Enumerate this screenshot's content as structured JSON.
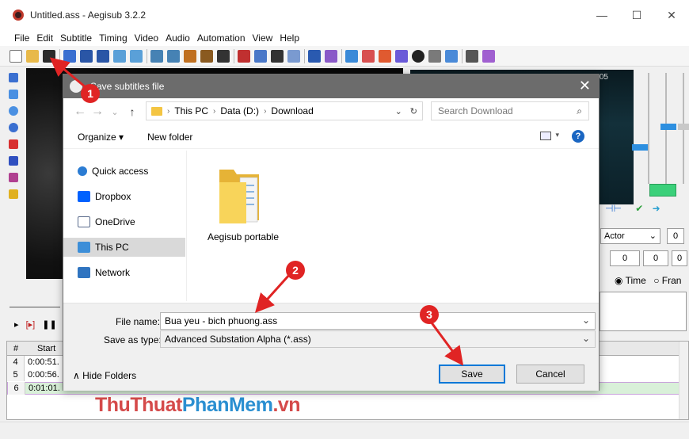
{
  "window": {
    "title": "Untitled.ass - Aegisub 3.2.2",
    "minimize": "—",
    "maximize": "☐",
    "close": "✕"
  },
  "menu": [
    "File",
    "Edit",
    "Subtitle",
    "Timing",
    "Video",
    "Audio",
    "Automation",
    "View",
    "Help"
  ],
  "right_panel": {
    "time_label": "05",
    "actor_label": "Actor",
    "actor_value": "0",
    "field_a": "0",
    "field_b": "0",
    "field_c": "0",
    "time_radio": "Time",
    "frame_radio": "Fran"
  },
  "grid": {
    "col_num": "#",
    "col_start": "Start",
    "rows": [
      {
        "num": "4",
        "start": "0:00:51."
      },
      {
        "num": "5",
        "start": "0:00:56."
      },
      {
        "num": "6",
        "start": "0:01:01."
      }
    ]
  },
  "watermark": {
    "part1": "ThuThuat",
    "part2": "PhanMem",
    "part3": ".vn"
  },
  "dialog": {
    "title": "Save subtitles file",
    "close": "✕",
    "back": "←",
    "forward": "→",
    "recent": "⌄",
    "up": "↑",
    "breadcrumbs": [
      "This PC",
      "Data (D:)",
      "Download"
    ],
    "crumb_sep": "›",
    "addr_dropdown": "⌄",
    "refresh": "↻",
    "search_placeholder": "Search Download",
    "search_icon": "⌕",
    "organize": "Organize ▾",
    "new_folder": "New folder",
    "view_dropdown": "▾",
    "help": "?",
    "nav": [
      {
        "label": "Quick access",
        "color": "#2b7cd3"
      },
      {
        "label": "Dropbox",
        "color": "#0061fe"
      },
      {
        "label": "OneDrive",
        "color": "#5a6b8c"
      },
      {
        "label": "This PC",
        "color": "#3c8ed8"
      },
      {
        "label": "Network",
        "color": "#2f74c0"
      }
    ],
    "folder_item": "Aegisub portable",
    "file_name_label": "File name:",
    "file_name_value": "Bua yeu - bich phuong.ass",
    "save_type_label": "Save as type:",
    "save_type_value": "Advanced Substation Alpha (*.ass)",
    "dropdown_glyph": "⌄",
    "hide_folders": "∧  Hide Folders",
    "save": "Save",
    "cancel": "Cancel"
  },
  "callouts": [
    "1",
    "2",
    "3"
  ],
  "colors": {
    "accent": "#0078d7",
    "callout": "#e02424"
  }
}
